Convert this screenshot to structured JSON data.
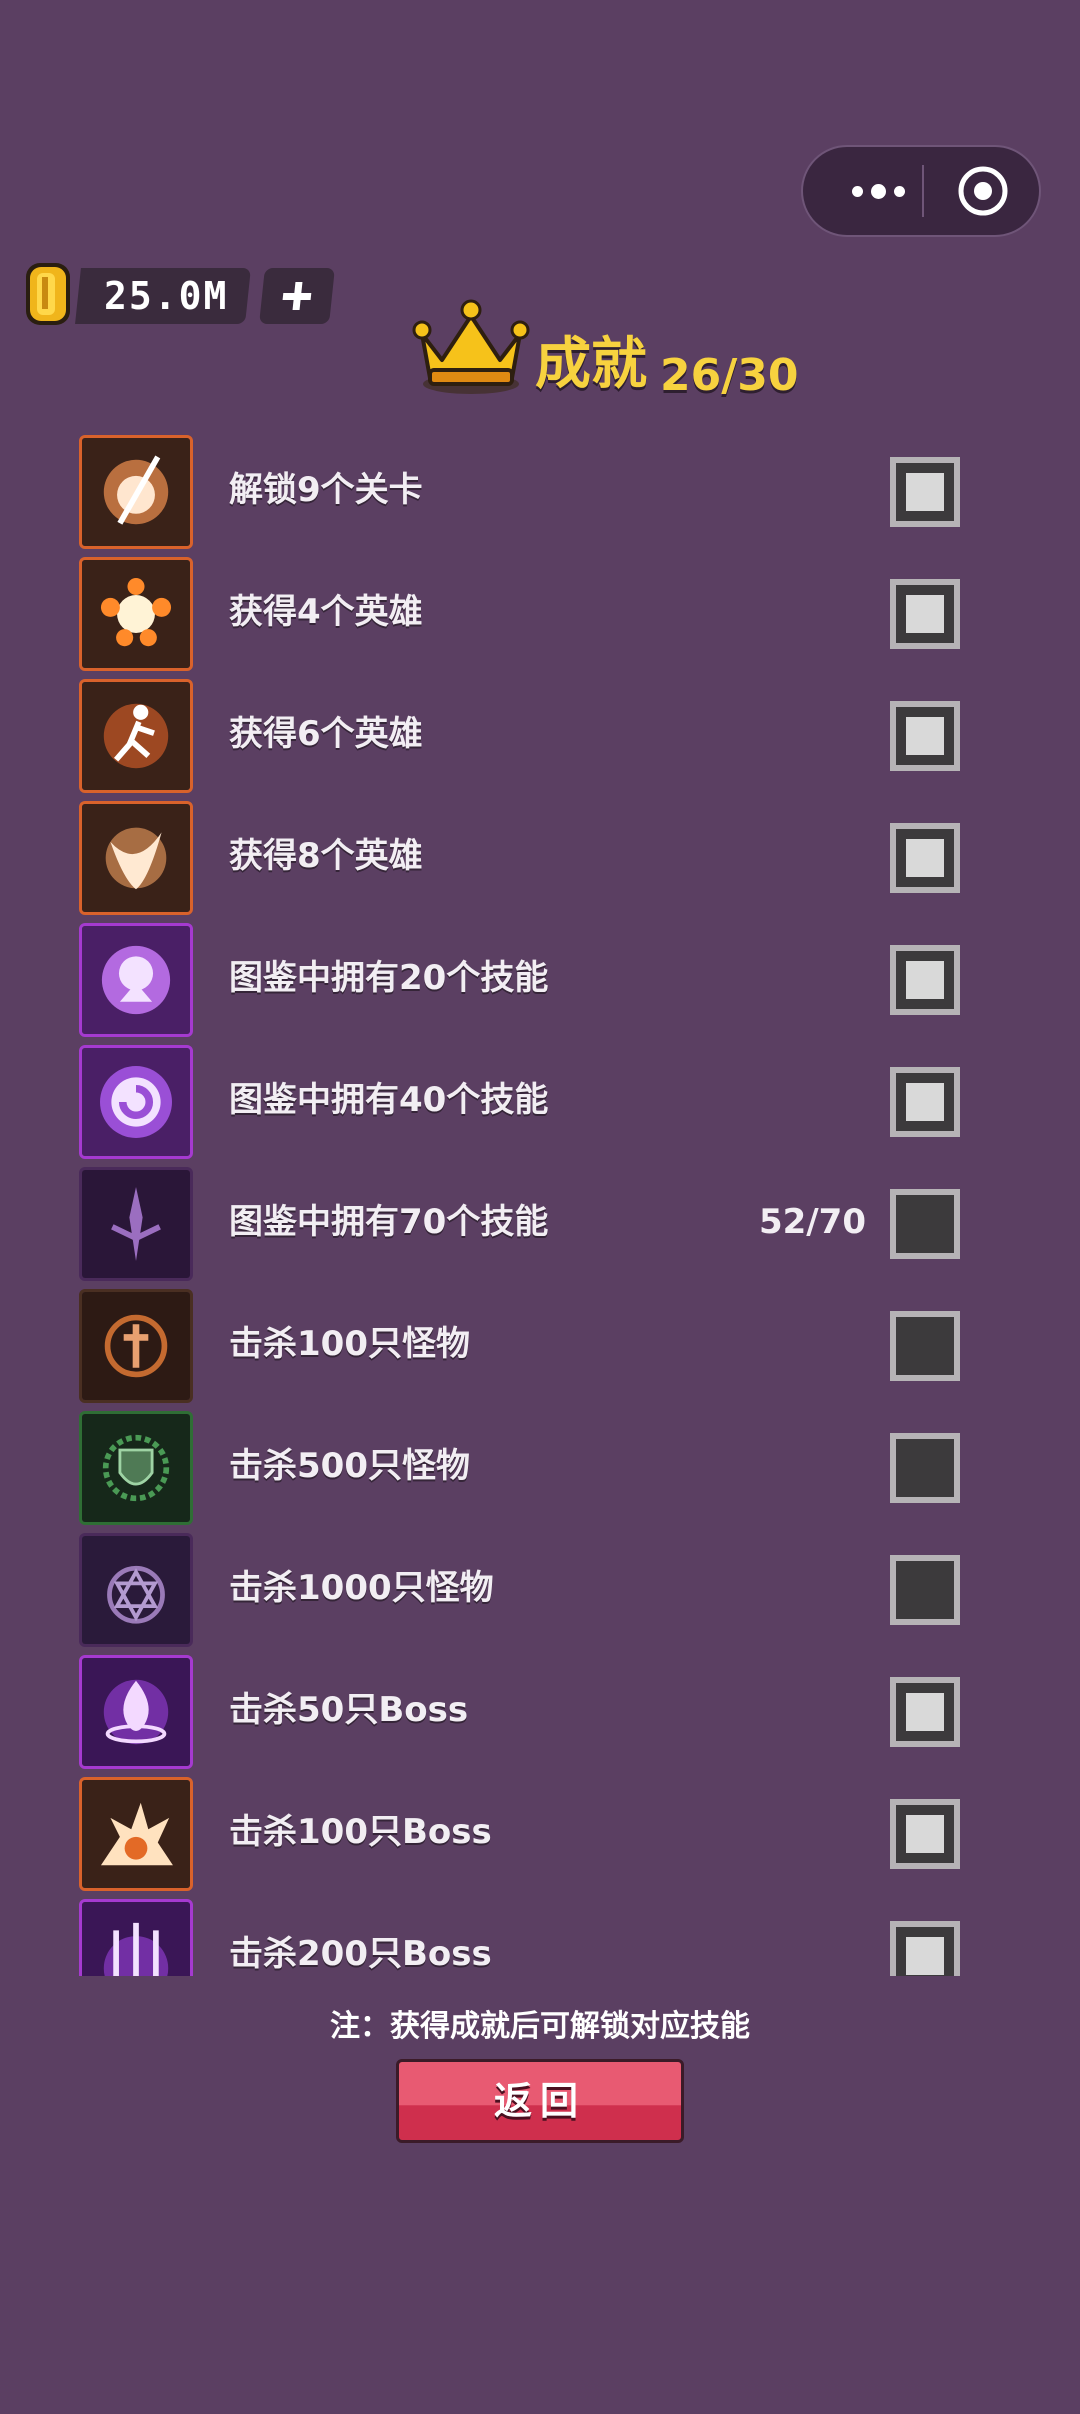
{
  "coins": {
    "value": "25.0M"
  },
  "header": {
    "title": "成就",
    "progress": "26/30"
  },
  "achievements": [
    {
      "label": "解锁9个关卡",
      "progress": "",
      "completed": true,
      "icon": "slash-flame-icon",
      "frame": "#d9622b"
    },
    {
      "label": "获得4个英雄",
      "progress": "",
      "completed": true,
      "icon": "fire-burst-icon",
      "frame": "#d9622b"
    },
    {
      "label": "获得6个英雄",
      "progress": "",
      "completed": true,
      "icon": "runner-flame-icon",
      "frame": "#d9622b"
    },
    {
      "label": "获得8个英雄",
      "progress": "",
      "completed": true,
      "icon": "phoenix-icon",
      "frame": "#d9622b"
    },
    {
      "label": "图鉴中拥有20个技能",
      "progress": "",
      "completed": true,
      "icon": "purple-bloom-icon",
      "frame": "#a53ad0"
    },
    {
      "label": "图鉴中拥有40个技能",
      "progress": "",
      "completed": true,
      "icon": "purple-swirl-icon",
      "frame": "#a53ad0"
    },
    {
      "label": "图鉴中拥有70个技能",
      "progress": "52/70",
      "completed": false,
      "icon": "dark-sword-icon",
      "frame": "#4a2a5a"
    },
    {
      "label": "击杀100只怪物",
      "progress": "",
      "completed": false,
      "icon": "cross-emblem-icon",
      "frame": "#4a2f22"
    },
    {
      "label": "击杀500只怪物",
      "progress": "",
      "completed": false,
      "icon": "green-shield-icon",
      "frame": "#2f6e35"
    },
    {
      "label": "击杀1000只怪物",
      "progress": "",
      "completed": false,
      "icon": "hexagram-emblem-icon",
      "frame": "#4a2a5a"
    },
    {
      "label": "击杀50只Boss",
      "progress": "",
      "completed": true,
      "icon": "purple-fire-icon",
      "frame": "#a53ad0"
    },
    {
      "label": "击杀100只Boss",
      "progress": "",
      "completed": true,
      "icon": "explosion-icon",
      "frame": "#d9622b"
    },
    {
      "label": "击杀200只Boss",
      "progress": "",
      "completed": true,
      "icon": "tridents-icon",
      "frame": "#a53ad0"
    }
  ],
  "footer": {
    "note": "注：获得成就后可解锁对应技能",
    "back_label": "返回"
  }
}
